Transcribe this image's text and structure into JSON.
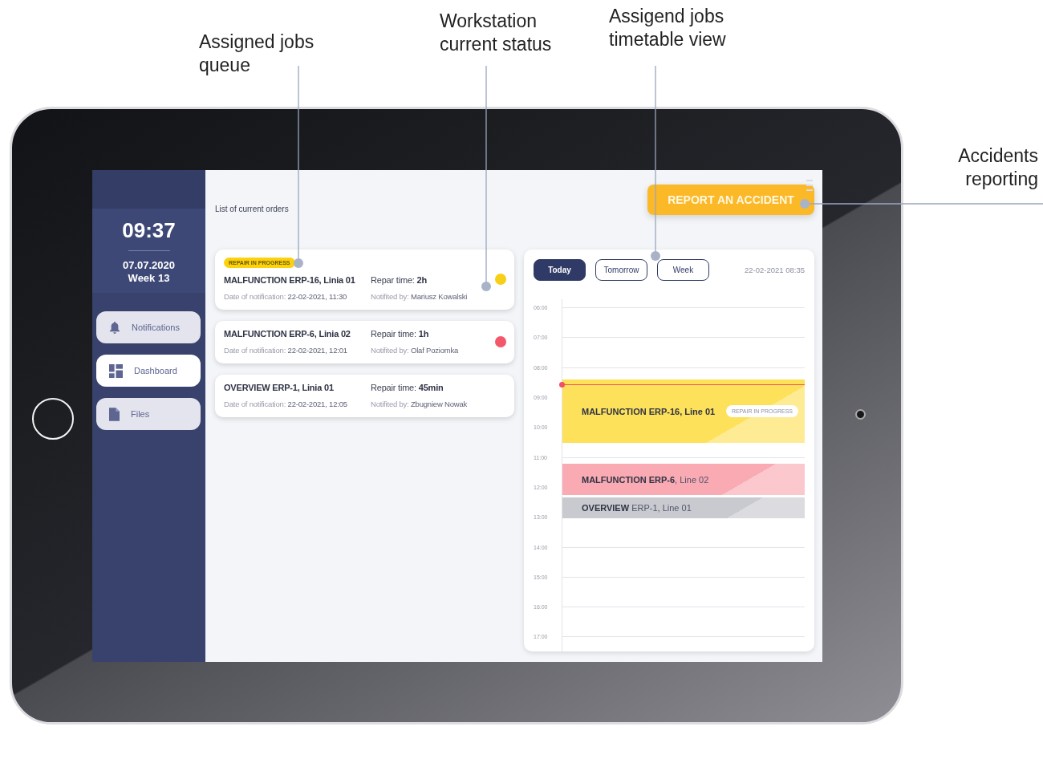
{
  "annotations": [
    {
      "lines": [
        "Assigned jobs",
        "queue"
      ]
    },
    {
      "lines": [
        "Workstation",
        "current status"
      ]
    },
    {
      "lines": [
        "Assigend jobs",
        "timetable view"
      ]
    },
    {
      "lines": [
        "Accidents",
        "reporting"
      ]
    }
  ],
  "sidebar": {
    "time": "09:37",
    "date": "07.07.2020",
    "week": "Week 13",
    "items": [
      {
        "label": "Notifications",
        "kind": "bell",
        "selected": false
      },
      {
        "label": "Dashboard",
        "kind": "grid",
        "selected": true
      },
      {
        "label": "Files",
        "kind": "file",
        "selected": false
      }
    ]
  },
  "header": {
    "title": "List of current orders",
    "report_button": "REPORT AN ACCIDENT"
  },
  "orders": [
    {
      "badge": "REPAIR IN PROGRESS",
      "title": "MALFUNCTION ERP-16, Linia 01",
      "repair_label": "Repar time:",
      "repair_time": "2h",
      "date_label": "Date of notification:",
      "date": "22-02-2021, 11:30",
      "notified_label": "Notifited by:",
      "notified_by": "Mariusz Kowalski",
      "color": "#f7cf16"
    },
    {
      "title": "MALFUNCTION ERP-6, Linia 02",
      "repair_label": "Repair time:",
      "repair_time": "1h",
      "date_label": "Date of notification:",
      "date": "22-02-2021, 12:01",
      "notified_label": "Notifited by:",
      "notified_by": "Olaf Poziomka",
      "color": "#f4566a"
    },
    {
      "title": "OVERVIEW ERP-1, Linia 01",
      "repair_label": "Repair time:",
      "repair_time": "45min",
      "date_label": "Date of notification:",
      "date": "22-02-2021, 12:05",
      "notified_label": "Notifited by:",
      "notified_by": "Zbugniew Nowak"
    }
  ],
  "timetable": {
    "tabs": [
      {
        "label": "Today",
        "selected": true
      },
      {
        "label": "Tomorrow",
        "selected": false
      },
      {
        "label": "Week",
        "selected": false
      }
    ],
    "datetime": "22-02-2021 08:35",
    "hours": [
      "06:00",
      "07:00",
      "08:00",
      "09:00",
      "10:00",
      "11:00",
      "12:00",
      "13:00",
      "14:00",
      "15:00",
      "16:00",
      "17:00"
    ],
    "events": [
      {
        "title": "**MALFUNCTION ERP-16, Line 01**",
        "badge": "REPAIR IN PROGRESS",
        "color": "#fde15a"
      },
      {
        "title": "**MALFUNCTION ERP-6**, Line 02",
        "color": "#f9aab3"
      },
      {
        "title": "**OVERVIEW** ERP-1, Line 01",
        "color": "#c9cacf"
      }
    ]
  }
}
